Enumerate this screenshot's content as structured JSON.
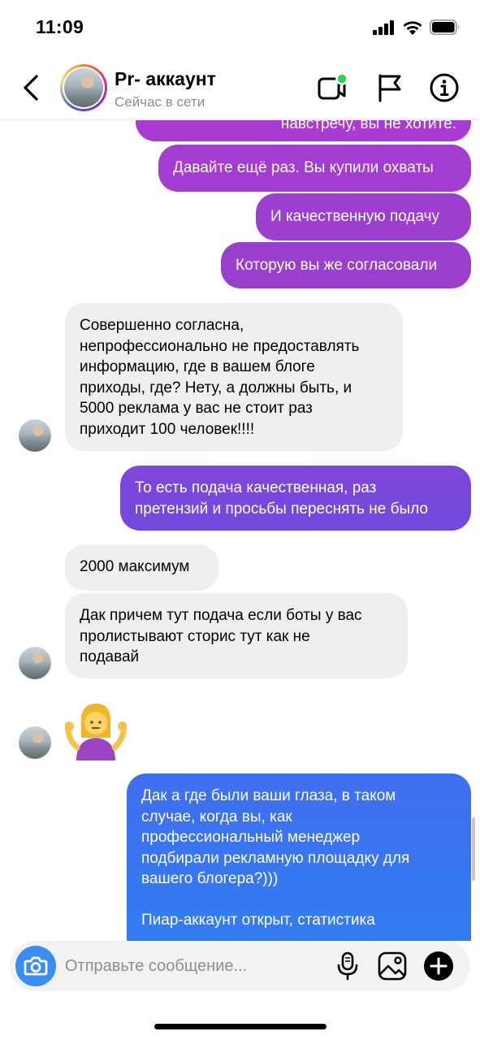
{
  "status_bar": {
    "time": "11:09"
  },
  "header": {
    "title": "Pr- аккаунт",
    "subtitle": "Сейчас в сети"
  },
  "messages": [
    {
      "direction": "out",
      "text": "навстречу, вы не хотите."
    },
    {
      "direction": "out",
      "text": "Давайте ещё раз. Вы купили охваты"
    },
    {
      "direction": "out",
      "text": "И качественную подачу"
    },
    {
      "direction": "out",
      "text": "Которую вы же согласовали"
    },
    {
      "direction": "in",
      "text": "Совершенно согласна,\nнепрофессионально не предоставлять\nинформацию, где в вашем блоге\nприходы, где? Нету, а должны быть, и\n5000 реклама у вас не стоит раз\nприходит 100 человек!!!!"
    },
    {
      "direction": "out",
      "text": "То есть подача качественная, раз\nпретензий и просьбы переснять не было"
    },
    {
      "direction": "in",
      "text": "2000 максимум"
    },
    {
      "direction": "in",
      "text": "Дак причем тут подача если боты у вас\nпролистывают сторис тут как не\nподавай"
    },
    {
      "direction": "in",
      "emoji": "person-shrugging-emoji"
    },
    {
      "direction": "out",
      "text": "Дак а где были ваши глаза, в таком\nслучае, когда вы, как\nпрофессиональный менеджер\nподбирали рекламную площадку для\nвашего блогера?)))\n\nПиар-аккаунт открыт, статистика"
    }
  ],
  "composer": {
    "placeholder": "Отправьте сообщение..."
  },
  "colors": {
    "incoming_bubble": "#efefef",
    "outgoing_gradient_top": "#a23bd0",
    "outgoing_gradient_mid": "#6b4fe0",
    "outgoing_gradient_bottom": "#3b79ec",
    "online_dot": "#2fd34b",
    "camera_button": "#3a8ef0"
  },
  "icons": [
    "chevron-left-icon",
    "video-call-icon",
    "flag-icon",
    "info-icon",
    "camera-icon",
    "microphone-icon",
    "gallery-icon",
    "plus-icon"
  ]
}
